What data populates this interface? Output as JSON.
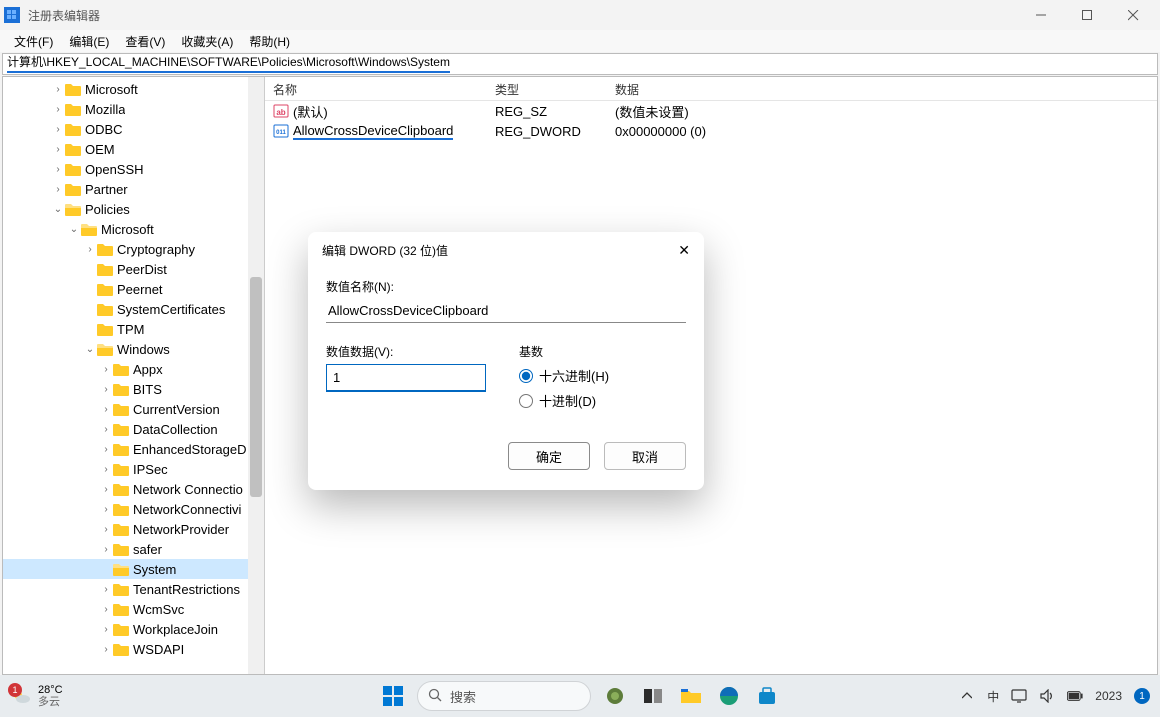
{
  "window": {
    "title": "注册表编辑器"
  },
  "menu": {
    "file": "文件(F)",
    "edit": "编辑(E)",
    "view": "查看(V)",
    "favorites": "收藏夹(A)",
    "help": "帮助(H)"
  },
  "address": {
    "full": "计算机\\HKEY_LOCAL_MACHINE\\SOFTWARE\\Policies\\Microsoft\\Windows\\System"
  },
  "tree": [
    {
      "depth": 3,
      "exp": ">",
      "label": "Microsoft"
    },
    {
      "depth": 3,
      "exp": ">",
      "label": "Mozilla"
    },
    {
      "depth": 3,
      "exp": ">",
      "label": "ODBC"
    },
    {
      "depth": 3,
      "exp": ">",
      "label": "OEM"
    },
    {
      "depth": 3,
      "exp": ">",
      "label": "OpenSSH"
    },
    {
      "depth": 3,
      "exp": ">",
      "label": "Partner"
    },
    {
      "depth": 3,
      "exp": "v",
      "label": "Policies",
      "open": true
    },
    {
      "depth": 4,
      "exp": "v",
      "label": "Microsoft",
      "open": true
    },
    {
      "depth": 5,
      "exp": ">",
      "label": "Cryptography"
    },
    {
      "depth": 5,
      "exp": "",
      "label": "PeerDist"
    },
    {
      "depth": 5,
      "exp": "",
      "label": "Peernet"
    },
    {
      "depth": 5,
      "exp": "",
      "label": "SystemCertificates"
    },
    {
      "depth": 5,
      "exp": "",
      "label": "TPM"
    },
    {
      "depth": 5,
      "exp": "v",
      "label": "Windows",
      "open": true
    },
    {
      "depth": 6,
      "exp": ">",
      "label": "Appx"
    },
    {
      "depth": 6,
      "exp": ">",
      "label": "BITS"
    },
    {
      "depth": 6,
      "exp": ">",
      "label": "CurrentVersion"
    },
    {
      "depth": 6,
      "exp": ">",
      "label": "DataCollection"
    },
    {
      "depth": 6,
      "exp": ">",
      "label": "EnhancedStorageD"
    },
    {
      "depth": 6,
      "exp": ">",
      "label": "IPSec"
    },
    {
      "depth": 6,
      "exp": ">",
      "label": "Network Connectio"
    },
    {
      "depth": 6,
      "exp": ">",
      "label": "NetworkConnectivi"
    },
    {
      "depth": 6,
      "exp": ">",
      "label": "NetworkProvider"
    },
    {
      "depth": 6,
      "exp": ">",
      "label": "safer"
    },
    {
      "depth": 6,
      "exp": "",
      "label": "System",
      "selected": true
    },
    {
      "depth": 6,
      "exp": ">",
      "label": "TenantRestrictions"
    },
    {
      "depth": 6,
      "exp": ">",
      "label": "WcmSvc"
    },
    {
      "depth": 6,
      "exp": ">",
      "label": "WorkplaceJoin"
    },
    {
      "depth": 6,
      "exp": ">",
      "label": "WSDAPI"
    }
  ],
  "columns": {
    "name": "名称",
    "type": "类型",
    "data": "数据"
  },
  "values": [
    {
      "icon": "sz",
      "name": "(默认)",
      "type": "REG_SZ",
      "data": "(数值未设置)"
    },
    {
      "icon": "dw",
      "name": "AllowCrossDeviceClipboard",
      "type": "REG_DWORD",
      "data": "0x00000000 (0)",
      "underline": true
    }
  ],
  "dialog": {
    "title": "编辑 DWORD (32 位)值",
    "name_label": "数值名称(N):",
    "name_value": "AllowCrossDeviceClipboard",
    "data_label": "数值数据(V):",
    "data_value": "1",
    "base_label": "基数",
    "hex": "十六进制(H)",
    "dec": "十进制(D)",
    "ok": "确定",
    "cancel": "取消"
  },
  "taskbar": {
    "temp": "28°C",
    "weather": "多云",
    "badge": "1",
    "search_placeholder": "搜索",
    "ime": "中",
    "clock": "2023",
    "notif": "1"
  }
}
